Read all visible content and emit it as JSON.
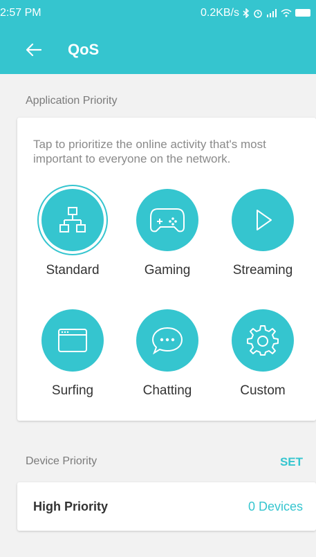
{
  "status_bar": {
    "time": "2:57 PM",
    "indicators": "0.2KB/s"
  },
  "app_bar": {
    "title": "QoS"
  },
  "application_priority": {
    "section_label": "Application Priority",
    "hint": "Tap to prioritize the online activity that's most important to everyone on the network.",
    "options": [
      {
        "label": "Standard",
        "icon": "network-topology-icon",
        "selected": true
      },
      {
        "label": "Gaming",
        "icon": "gamepad-icon",
        "selected": false
      },
      {
        "label": "Streaming",
        "icon": "play-icon",
        "selected": false
      },
      {
        "label": "Surfing",
        "icon": "browser-window-icon",
        "selected": false
      },
      {
        "label": "Chatting",
        "icon": "chat-bubble-icon",
        "selected": false
      },
      {
        "label": "Custom",
        "icon": "gear-icon",
        "selected": false
      }
    ]
  },
  "device_priority": {
    "section_label": "Device Priority",
    "set_label": "SET",
    "row_label": "High Priority",
    "row_value": "0 Devices"
  },
  "colors": {
    "accent": "#35c5cf",
    "background": "#f2f2f2",
    "card": "#ffffff"
  }
}
